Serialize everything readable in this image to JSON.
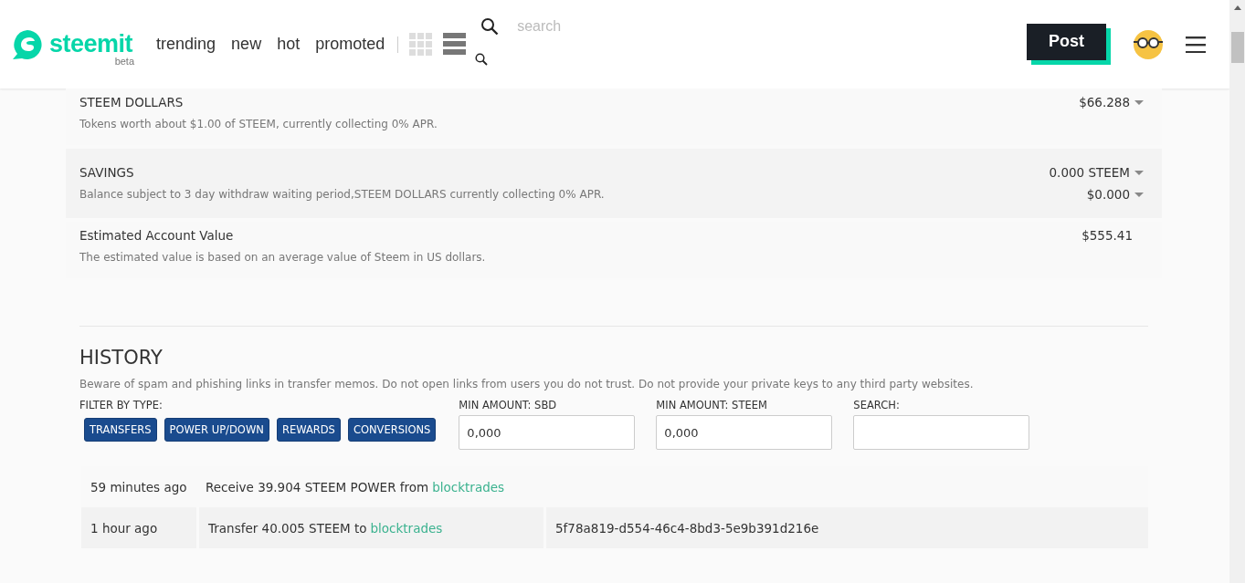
{
  "header": {
    "logo": "steemit",
    "logo_badge": "beta",
    "nav": [
      {
        "label": "trending"
      },
      {
        "label": "new"
      },
      {
        "label": "hot"
      },
      {
        "label": "promoted"
      }
    ],
    "search": {
      "placeholder": "search"
    },
    "post_button": "Post"
  },
  "balances": [
    {
      "title": "STEEM DOLLARS",
      "description": "Tokens worth about $1.00 of STEEM, currently collecting 0% APR.",
      "shaded": false,
      "amounts": [
        {
          "text": "$66.288",
          "dropdown": true
        }
      ]
    },
    {
      "title": "SAVINGS",
      "description": "Balance subject to 3 day withdraw waiting period,STEEM DOLLARS currently collecting 0% APR.",
      "shaded": true,
      "amounts": [
        {
          "text": "0.000 STEEM",
          "dropdown": true
        },
        {
          "text": "$0.000",
          "dropdown": true
        }
      ]
    },
    {
      "title": "Estimated Account Value",
      "description": "The estimated value is based on an average value of Steem in US dollars.",
      "shaded": false,
      "amounts": [
        {
          "text": "$555.41",
          "dropdown": false
        }
      ]
    }
  ],
  "history": {
    "title": "HISTORY",
    "warning": "Beware of spam and phishing links in transfer memos. Do not open links from users you do not trust. Do not provide your private keys to any third party websites.",
    "filter_label": "FILTER BY TYPE:",
    "filters": [
      "TRANSFERS",
      "POWER UP/DOWN",
      "REWARDS",
      "CONVERSIONS"
    ],
    "fields": [
      {
        "label": "MIN AMOUNT: SBD",
        "value": "0,000"
      },
      {
        "label": "MIN AMOUNT: STEEM",
        "value": "0,000"
      },
      {
        "label": "SEARCH:"
      }
    ],
    "rows": [
      {
        "time": "59 minutes ago",
        "text": "Receive 39.904 STEEM POWER from",
        "link": "blocktrades",
        "shaded": false
      },
      {
        "time": "1 hour ago",
        "text": "Transfer 40.005 STEEM to",
        "link": "blocktrades",
        "memo": "5f78a819-d554-46c4-8bd3-5e9b391d216e",
        "shaded": true
      }
    ]
  }
}
